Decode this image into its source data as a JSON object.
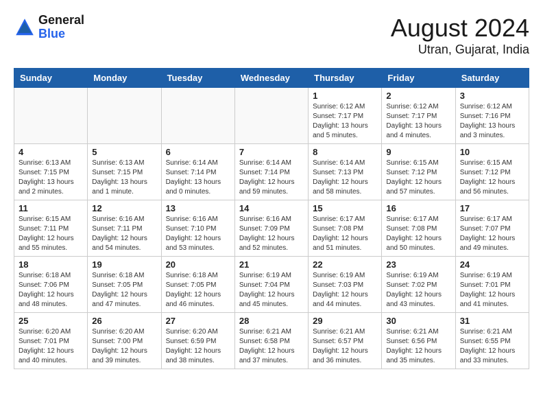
{
  "header": {
    "logo_general": "General",
    "logo_blue": "Blue",
    "title": "August 2024",
    "subtitle": "Utran, Gujarat, India"
  },
  "calendar": {
    "headers": [
      "Sunday",
      "Monday",
      "Tuesday",
      "Wednesday",
      "Thursday",
      "Friday",
      "Saturday"
    ],
    "weeks": [
      [
        {
          "day": "",
          "info": ""
        },
        {
          "day": "",
          "info": ""
        },
        {
          "day": "",
          "info": ""
        },
        {
          "day": "",
          "info": ""
        },
        {
          "day": "1",
          "info": "Sunrise: 6:12 AM\nSunset: 7:17 PM\nDaylight: 13 hours\nand 5 minutes."
        },
        {
          "day": "2",
          "info": "Sunrise: 6:12 AM\nSunset: 7:17 PM\nDaylight: 13 hours\nand 4 minutes."
        },
        {
          "day": "3",
          "info": "Sunrise: 6:12 AM\nSunset: 7:16 PM\nDaylight: 13 hours\nand 3 minutes."
        }
      ],
      [
        {
          "day": "4",
          "info": "Sunrise: 6:13 AM\nSunset: 7:15 PM\nDaylight: 13 hours\nand 2 minutes."
        },
        {
          "day": "5",
          "info": "Sunrise: 6:13 AM\nSunset: 7:15 PM\nDaylight: 13 hours\nand 1 minute."
        },
        {
          "day": "6",
          "info": "Sunrise: 6:14 AM\nSunset: 7:14 PM\nDaylight: 13 hours\nand 0 minutes."
        },
        {
          "day": "7",
          "info": "Sunrise: 6:14 AM\nSunset: 7:14 PM\nDaylight: 12 hours\nand 59 minutes."
        },
        {
          "day": "8",
          "info": "Sunrise: 6:14 AM\nSunset: 7:13 PM\nDaylight: 12 hours\nand 58 minutes."
        },
        {
          "day": "9",
          "info": "Sunrise: 6:15 AM\nSunset: 7:12 PM\nDaylight: 12 hours\nand 57 minutes."
        },
        {
          "day": "10",
          "info": "Sunrise: 6:15 AM\nSunset: 7:12 PM\nDaylight: 12 hours\nand 56 minutes."
        }
      ],
      [
        {
          "day": "11",
          "info": "Sunrise: 6:15 AM\nSunset: 7:11 PM\nDaylight: 12 hours\nand 55 minutes."
        },
        {
          "day": "12",
          "info": "Sunrise: 6:16 AM\nSunset: 7:11 PM\nDaylight: 12 hours\nand 54 minutes."
        },
        {
          "day": "13",
          "info": "Sunrise: 6:16 AM\nSunset: 7:10 PM\nDaylight: 12 hours\nand 53 minutes."
        },
        {
          "day": "14",
          "info": "Sunrise: 6:16 AM\nSunset: 7:09 PM\nDaylight: 12 hours\nand 52 minutes."
        },
        {
          "day": "15",
          "info": "Sunrise: 6:17 AM\nSunset: 7:08 PM\nDaylight: 12 hours\nand 51 minutes."
        },
        {
          "day": "16",
          "info": "Sunrise: 6:17 AM\nSunset: 7:08 PM\nDaylight: 12 hours\nand 50 minutes."
        },
        {
          "day": "17",
          "info": "Sunrise: 6:17 AM\nSunset: 7:07 PM\nDaylight: 12 hours\nand 49 minutes."
        }
      ],
      [
        {
          "day": "18",
          "info": "Sunrise: 6:18 AM\nSunset: 7:06 PM\nDaylight: 12 hours\nand 48 minutes."
        },
        {
          "day": "19",
          "info": "Sunrise: 6:18 AM\nSunset: 7:05 PM\nDaylight: 12 hours\nand 47 minutes."
        },
        {
          "day": "20",
          "info": "Sunrise: 6:18 AM\nSunset: 7:05 PM\nDaylight: 12 hours\nand 46 minutes."
        },
        {
          "day": "21",
          "info": "Sunrise: 6:19 AM\nSunset: 7:04 PM\nDaylight: 12 hours\nand 45 minutes."
        },
        {
          "day": "22",
          "info": "Sunrise: 6:19 AM\nSunset: 7:03 PM\nDaylight: 12 hours\nand 44 minutes."
        },
        {
          "day": "23",
          "info": "Sunrise: 6:19 AM\nSunset: 7:02 PM\nDaylight: 12 hours\nand 43 minutes."
        },
        {
          "day": "24",
          "info": "Sunrise: 6:19 AM\nSunset: 7:01 PM\nDaylight: 12 hours\nand 41 minutes."
        }
      ],
      [
        {
          "day": "25",
          "info": "Sunrise: 6:20 AM\nSunset: 7:01 PM\nDaylight: 12 hours\nand 40 minutes."
        },
        {
          "day": "26",
          "info": "Sunrise: 6:20 AM\nSunset: 7:00 PM\nDaylight: 12 hours\nand 39 minutes."
        },
        {
          "day": "27",
          "info": "Sunrise: 6:20 AM\nSunset: 6:59 PM\nDaylight: 12 hours\nand 38 minutes."
        },
        {
          "day": "28",
          "info": "Sunrise: 6:21 AM\nSunset: 6:58 PM\nDaylight: 12 hours\nand 37 minutes."
        },
        {
          "day": "29",
          "info": "Sunrise: 6:21 AM\nSunset: 6:57 PM\nDaylight: 12 hours\nand 36 minutes."
        },
        {
          "day": "30",
          "info": "Sunrise: 6:21 AM\nSunset: 6:56 PM\nDaylight: 12 hours\nand 35 minutes."
        },
        {
          "day": "31",
          "info": "Sunrise: 6:21 AM\nSunset: 6:55 PM\nDaylight: 12 hours\nand 33 minutes."
        }
      ]
    ]
  }
}
